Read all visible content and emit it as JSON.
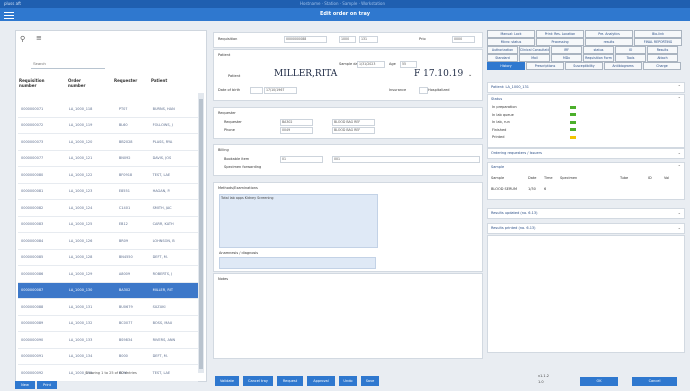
{
  "window": {
    "title": "pluss aft",
    "subtitle": "Hostname · Station · Sample · Workstation"
  },
  "app": {
    "title": "Edit order on tray"
  },
  "left": {
    "search_placeholder": "Search",
    "columns": [
      "Requisition number",
      "Order number",
      "Requester",
      "Patient"
    ],
    "rows": [
      [
        "0000000071",
        "LA_1000_118",
        "PT07",
        "BURNS, HAN"
      ],
      [
        "0000000072",
        "LA_1000_119",
        "BL60",
        "FOLLOWS, J"
      ],
      [
        "0000000073",
        "LA_1000_120",
        "BB2028",
        "PLASS, RYA"
      ],
      [
        "0000000077",
        "LA_1000_121",
        "BN092",
        "DAVIS, JOS"
      ],
      [
        "0000000080",
        "LA_1000_122",
        "BF0918",
        "TEST, LAE"
      ],
      [
        "0000000081",
        "LA_1000_123",
        "E8551",
        "HAGAN, P."
      ],
      [
        "0000000082",
        "LA_1000_124",
        "C1401",
        "SMITH, JAC"
      ],
      [
        "0000000083",
        "LA_1000_125",
        "EB12",
        "CARR, KATH"
      ],
      [
        "0000000084",
        "LA_1000_126",
        "BR09",
        "LOHNSON, B"
      ],
      [
        "0000000085",
        "LA_1000_128",
        "BN4550",
        "DEFT, M."
      ],
      [
        "0000000086",
        "LA_1000_129",
        "A8009",
        "ROBERTS, J"
      ],
      [
        "0000000087",
        "LA_1000_130",
        "BA302",
        "MILLER, RIT"
      ],
      [
        "0000000088",
        "LA_1000_131",
        "BU0679",
        "SUZUKI"
      ],
      [
        "0000000089",
        "LA_1000_132",
        "BC0077",
        "BOSS, MAU"
      ],
      [
        "0000000090",
        "LA_1000_133",
        "BS9834",
        "RIVERS, ANN"
      ],
      [
        "0000000091",
        "LA_1000_134",
        "B000",
        "DEFT, M."
      ],
      [
        "0000000092",
        "LA_1000_135",
        "EL90",
        "TEST, LAE"
      ]
    ],
    "selected_row": 11,
    "paging": "Showing 1 to 25 of 60 entries",
    "buttons": [
      "New",
      "Print"
    ]
  },
  "middle": {
    "requisition_label": "Requisition",
    "requisition_value": "0000000088",
    "id_value": "1000",
    "ord_value": "131",
    "priority_label": "Prio",
    "priority_value": "0000",
    "patient_section": "Patient",
    "sample_label": "Sample date",
    "sample_value": "1/31/2023",
    "age_label": "Age",
    "age_value": "55",
    "patient_label": "Patient",
    "patient_name": "MILLER,RITA",
    "patient_dob": "F 17.10.19",
    "dob_label": "Date of birth",
    "dob_value": "17/10/1967",
    "ins_label": "Insurance",
    "ins_value": "Hospitalized",
    "requester_section": "Requester",
    "requester_label": "Requester",
    "requester_value": "BA302",
    "phone_label": "Phone",
    "phone_value": "0049",
    "requester_extra1": "BLOOD BAG REF",
    "requester_extra2": "BLOOD BAG REF",
    "billing_section": "Billing",
    "billing_label1": "Bookable item",
    "billing_value1": "01",
    "billing_label2": "Specimen forwarding",
    "billing_value2": "001",
    "methods_section": "Methods/Examinations",
    "methods_value": "Total lab apps Kidney Screening",
    "diag_label": "Anamnesis / diagnosis",
    "notes_section": "Notes",
    "buttons": [
      "Validate",
      "Cancel tray",
      "Request",
      "Approval",
      "Undo",
      "Save"
    ]
  },
  "right": {
    "tabs_row1": [
      "Manual: Lock",
      "Print: Res. Location",
      "Pre. Analytics",
      "Bio-link"
    ],
    "tabs_row2": [
      "Micro: status",
      "Processing",
      "results",
      "FINAL REPORTING"
    ],
    "tabs_row3": [
      "Authorization",
      "Clinical Consultation",
      "IRF",
      "status",
      "IO",
      "Results"
    ],
    "tabs_row4": [
      "Standard",
      "Mail",
      "MDx",
      "Requisition Form",
      "Tools",
      "Attach"
    ],
    "tabs_row5": [
      "History",
      "Prescriptions",
      "Susceptibility",
      "Antibiograms",
      "Charge"
    ],
    "patient_header": "Patient: LA_1000_131",
    "status_header": "Status",
    "status_rows": [
      {
        "label": "In preparation",
        "color": "#4caf2b"
      },
      {
        "label": "In lab queue",
        "color": "#4caf2b"
      },
      {
        "label": "In lab, run",
        "color": "#4caf2b"
      },
      {
        "label": "Finished",
        "color": "#4caf2b"
      },
      {
        "label": "Printed",
        "color": "#f2c400"
      }
    ],
    "ordering_header": "Ordering requesters / Issuers",
    "sample_header": "Sample",
    "sample_cols": [
      "Sample",
      "Date",
      "Time",
      "Specimen",
      "Tube",
      "ID",
      "Vol"
    ],
    "sample_row": [
      "BLOOD SERUM",
      "1/30",
      "6"
    ],
    "results_header": "Results updated (no. 6.13)",
    "results2_header": "Results printed (no. 6.13)"
  },
  "footer": {
    "version": "v1.1.2",
    "version2": "1.0",
    "ok": "OK",
    "cancel": "Cancel"
  }
}
